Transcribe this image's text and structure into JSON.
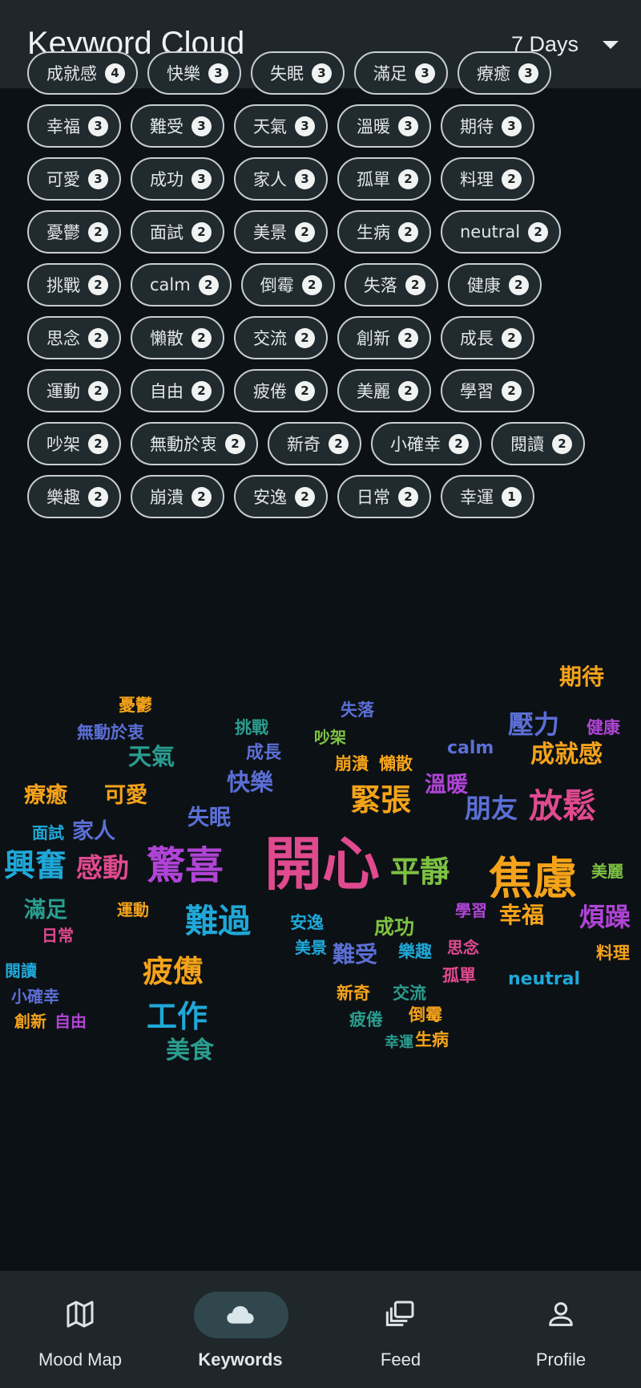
{
  "header": {
    "title": "Keyword Cloud",
    "range_label": "7 Days"
  },
  "chips": [
    {
      "label": "成就感",
      "count": "4"
    },
    {
      "label": "快樂",
      "count": "3"
    },
    {
      "label": "失眠",
      "count": "3"
    },
    {
      "label": "滿足",
      "count": "3"
    },
    {
      "label": "療癒",
      "count": "3"
    },
    {
      "label": "幸福",
      "count": "3"
    },
    {
      "label": "難受",
      "count": "3"
    },
    {
      "label": "天氣",
      "count": "3"
    },
    {
      "label": "溫暖",
      "count": "3"
    },
    {
      "label": "期待",
      "count": "3"
    },
    {
      "label": "可愛",
      "count": "3"
    },
    {
      "label": "成功",
      "count": "3"
    },
    {
      "label": "家人",
      "count": "3"
    },
    {
      "label": "孤單",
      "count": "2"
    },
    {
      "label": "料理",
      "count": "2"
    },
    {
      "label": "憂鬱",
      "count": "2"
    },
    {
      "label": "面試",
      "count": "2"
    },
    {
      "label": "美景",
      "count": "2"
    },
    {
      "label": "生病",
      "count": "2"
    },
    {
      "label": "neutral",
      "count": "2"
    },
    {
      "label": "挑戰",
      "count": "2"
    },
    {
      "label": "calm",
      "count": "2"
    },
    {
      "label": "倒霉",
      "count": "2"
    },
    {
      "label": "失落",
      "count": "2"
    },
    {
      "label": "健康",
      "count": "2"
    },
    {
      "label": "思念",
      "count": "2"
    },
    {
      "label": "懶散",
      "count": "2"
    },
    {
      "label": "交流",
      "count": "2"
    },
    {
      "label": "創新",
      "count": "2"
    },
    {
      "label": "成長",
      "count": "2"
    },
    {
      "label": "運動",
      "count": "2"
    },
    {
      "label": "自由",
      "count": "2"
    },
    {
      "label": "疲倦",
      "count": "2"
    },
    {
      "label": "美麗",
      "count": "2"
    },
    {
      "label": "學習",
      "count": "2"
    },
    {
      "label": "吵架",
      "count": "2"
    },
    {
      "label": "無動於衷",
      "count": "2"
    },
    {
      "label": "新奇",
      "count": "2"
    },
    {
      "label": "小確幸",
      "count": "2"
    },
    {
      "label": "閱讀",
      "count": "2"
    },
    {
      "label": "樂趣",
      "count": "2"
    },
    {
      "label": "崩潰",
      "count": "2"
    },
    {
      "label": "安逸",
      "count": "2"
    },
    {
      "label": "日常",
      "count": "2"
    },
    {
      "label": "幸運",
      "count": "1"
    }
  ],
  "cloud": [
    {
      "text": "期待",
      "color": "#f5a31a",
      "size": 28
    },
    {
      "text": "憂鬱",
      "color": "#f5a31a",
      "size": 21
    },
    {
      "text": "失落",
      "color": "#5b6fd6",
      "size": 21
    },
    {
      "text": "壓力",
      "color": "#5b6fd6",
      "size": 32
    },
    {
      "text": "健康",
      "color": "#b044d6",
      "size": 21
    },
    {
      "text": "無動於衷",
      "color": "#5b6fd6",
      "size": 21
    },
    {
      "text": "挑戰",
      "color": "#2a9d8f",
      "size": 21
    },
    {
      "text": "吵架",
      "color": "#7dc242",
      "size": 20
    },
    {
      "text": "calm",
      "color": "#5b6fd6",
      "size": 22
    },
    {
      "text": "天氣",
      "color": "#2a9d8f",
      "size": 29
    },
    {
      "text": "成長",
      "color": "#5b6fd6",
      "size": 22
    },
    {
      "text": "崩潰",
      "color": "#f5a31a",
      "size": 21
    },
    {
      "text": "懶散",
      "color": "#f5a31a",
      "size": 21
    },
    {
      "text": "成就感",
      "color": "#f5a31a",
      "size": 30
    },
    {
      "text": "快樂",
      "color": "#5b6fd6",
      "size": 29
    },
    {
      "text": "溫暖",
      "color": "#b044d6",
      "size": 27
    },
    {
      "text": "療癒",
      "color": "#f5a31a",
      "size": 27
    },
    {
      "text": "可愛",
      "color": "#f5a31a",
      "size": 27
    },
    {
      "text": "緊張",
      "color": "#f5a31a",
      "size": 38
    },
    {
      "text": "朋友",
      "color": "#5b6fd6",
      "size": 33
    },
    {
      "text": "放鬆",
      "color": "#e04a8f",
      "size": 42
    },
    {
      "text": "失眠",
      "color": "#5b6fd6",
      "size": 27
    },
    {
      "text": "面試",
      "color": "#1fa8d8",
      "size": 20
    },
    {
      "text": "家人",
      "color": "#5b6fd6",
      "size": 27
    },
    {
      "text": "興奮",
      "color": "#1fa8d8",
      "size": 39
    },
    {
      "text": "感動",
      "color": "#e04a8f",
      "size": 33
    },
    {
      "text": "驚喜",
      "color": "#b044d6",
      "size": 48
    },
    {
      "text": "開心",
      "color": "#e04a8f",
      "size": 72
    },
    {
      "text": "平靜",
      "color": "#7dc242",
      "size": 37
    },
    {
      "text": "焦慮",
      "color": "#f5a31a",
      "size": 55
    },
    {
      "text": "美麗",
      "color": "#7dc242",
      "size": 20
    },
    {
      "text": "滿足",
      "color": "#2a9d8f",
      "size": 27
    },
    {
      "text": "運動",
      "color": "#f5a31a",
      "size": 20
    },
    {
      "text": "難過",
      "color": "#1fa8d8",
      "size": 41
    },
    {
      "text": "安逸",
      "color": "#1fa8d8",
      "size": 21
    },
    {
      "text": "成功",
      "color": "#7dc242",
      "size": 25
    },
    {
      "text": "學習",
      "color": "#b044d6",
      "size": 20
    },
    {
      "text": "幸福",
      "color": "#f5a31a",
      "size": 28
    },
    {
      "text": "煩躁",
      "color": "#b044d6",
      "size": 32
    },
    {
      "text": "日常",
      "color": "#e04a8f",
      "size": 20
    },
    {
      "text": "美景",
      "color": "#1fa8d8",
      "size": 20
    },
    {
      "text": "難受",
      "color": "#5b6fd6",
      "size": 28
    },
    {
      "text": "樂趣",
      "color": "#1fa8d8",
      "size": 21
    },
    {
      "text": "思念",
      "color": "#e04a8f",
      "size": 20
    },
    {
      "text": "料理",
      "color": "#f5a31a",
      "size": 21
    },
    {
      "text": "閱讀",
      "color": "#1fa8d8",
      "size": 20
    },
    {
      "text": "疲憊",
      "color": "#f5a31a",
      "size": 38
    },
    {
      "text": "孤單",
      "color": "#e04a8f",
      "size": 21
    },
    {
      "text": "neutral",
      "color": "#1fa8d8",
      "size": 22
    },
    {
      "text": "小確幸",
      "color": "#5b6fd6",
      "size": 20
    },
    {
      "text": "新奇",
      "color": "#f5a31a",
      "size": 21
    },
    {
      "text": "交流",
      "color": "#2a9d8f",
      "size": 21
    },
    {
      "text": "創新",
      "color": "#f5a31a",
      "size": 20
    },
    {
      "text": "自由",
      "color": "#b044d6",
      "size": 20
    },
    {
      "text": "疲倦",
      "color": "#2a9d8f",
      "size": 21
    },
    {
      "text": "倒霉",
      "color": "#f5a31a",
      "size": 21
    },
    {
      "text": "工作",
      "color": "#1fa8d8",
      "size": 38
    },
    {
      "text": "幸運",
      "color": "#2a9d8f",
      "size": 18
    },
    {
      "text": "生病",
      "color": "#f5a31a",
      "size": 21
    },
    {
      "text": "美食",
      "color": "#2a9d8f",
      "size": 30
    }
  ],
  "nav": {
    "items": [
      {
        "label": "Mood Map",
        "icon": "map-icon"
      },
      {
        "label": "Keywords",
        "icon": "cloud-icon"
      },
      {
        "label": "Feed",
        "icon": "feed-icon"
      },
      {
        "label": "Profile",
        "icon": "person-icon"
      }
    ],
    "active": "Keywords"
  }
}
